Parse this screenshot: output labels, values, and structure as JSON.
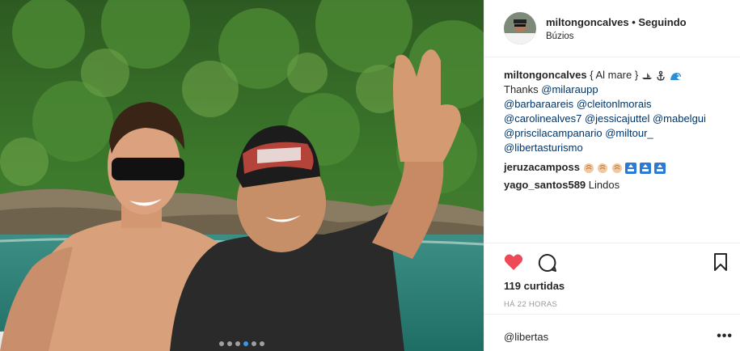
{
  "header": {
    "username": "miltongoncalves",
    "separator": "•",
    "follow_status": "Seguindo",
    "location": "Búzios"
  },
  "caption": {
    "username": "miltongoncalves",
    "text": "{ Al mare }",
    "line2_prefix": "Thanks",
    "mentions": [
      "@milaraupp",
      "@barbaraareis",
      "@cleitonlmorais",
      "@carolinealves7",
      "@jessicajuttel",
      "@mabelgui",
      "@priscilacampanario",
      "@miltour_",
      "@libertasturismo"
    ]
  },
  "comments": [
    {
      "username": "jeruzacamposs",
      "text": ""
    },
    {
      "username": "yago_santos589",
      "text": "Lindos"
    }
  ],
  "actions": {
    "likes": "119 curtidas",
    "time": "HÁ 22 HORAS"
  },
  "comment_box": {
    "text": "@libertas",
    "more": "•••"
  },
  "carousel": {
    "count": 6,
    "active": 3
  },
  "colors": {
    "like": "#ed4956",
    "link": "#003569",
    "active_dot": "#3897f0"
  }
}
